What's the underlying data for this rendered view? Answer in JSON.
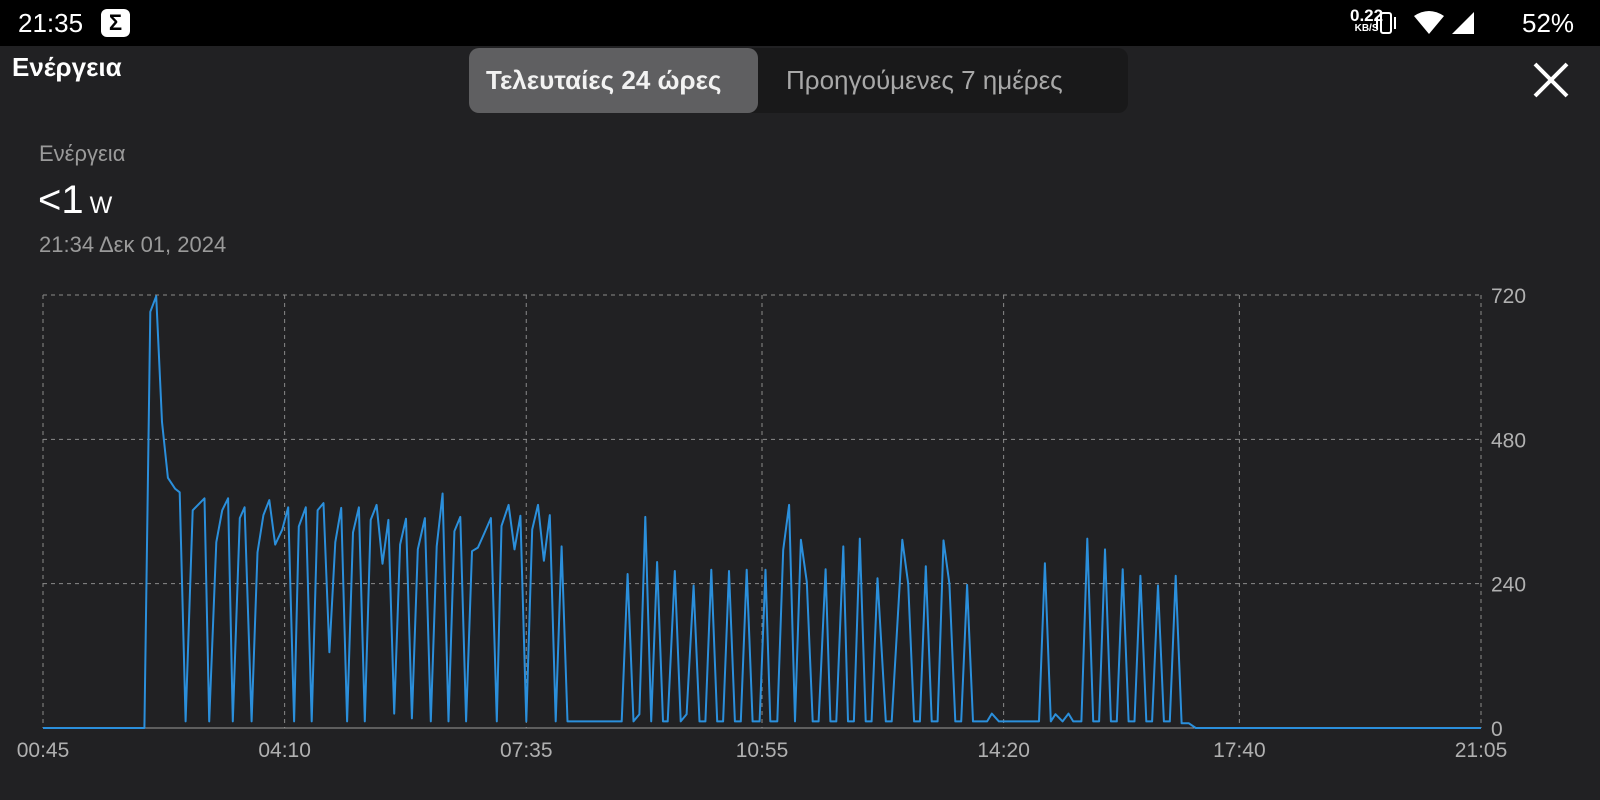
{
  "status_bar": {
    "time": "21:35",
    "app_icon": "sigma-icon",
    "app_icon_glyph": "Σ",
    "net_speed": "0.22",
    "net_unit": "KB/S",
    "battery": "52%"
  },
  "header": {
    "title": "Ενέργεια",
    "tabs": [
      {
        "label": "Τελευταίες 24 ώρες",
        "active": true
      },
      {
        "label": "Προηγούμενες 7 ημέρες",
        "active": false
      }
    ],
    "close_icon": "close-icon"
  },
  "summary": {
    "label": "Ενέργεια",
    "value": "<1",
    "unit": "W",
    "timestamp": "21:34  Δεκ 01, 2024"
  },
  "colors": {
    "line": "#2b8fdb",
    "background": "#212123",
    "grid": "#8a8a8a"
  },
  "chart_data": {
    "type": "line",
    "title": "",
    "xlabel": "",
    "ylabel": "W",
    "x_unit": "minutes since 00:45",
    "x_ticks": [
      {
        "label": "00:45",
        "value": 0
      },
      {
        "label": "04:10",
        "value": 205
      },
      {
        "label": "07:35",
        "value": 410
      },
      {
        "label": "10:55",
        "value": 610
      },
      {
        "label": "14:20",
        "value": 815
      },
      {
        "label": "17:40",
        "value": 1015
      },
      {
        "label": "21:05",
        "value": 1220
      }
    ],
    "xlim": [
      0,
      1220
    ],
    "y_ticks": [
      {
        "label": "720",
        "value": 720
      },
      {
        "label": "480",
        "value": 480
      },
      {
        "label": "240",
        "value": 240
      },
      {
        "label": "0",
        "value": 0
      }
    ],
    "ylim": [
      0,
      720
    ],
    "grid": true,
    "legend": "none",
    "series": [
      {
        "name": "Ενέργεια",
        "points": [
          [
            0,
            0
          ],
          [
            86,
            0
          ],
          [
            91,
            692
          ],
          [
            96,
            718
          ],
          [
            101,
            509
          ],
          [
            106,
            416
          ],
          [
            112,
            398
          ],
          [
            116,
            392
          ],
          [
            121,
            11
          ],
          [
            127,
            362
          ],
          [
            137,
            382
          ],
          [
            141,
            11
          ],
          [
            147,
            309
          ],
          [
            152,
            362
          ],
          [
            157,
            382
          ],
          [
            161,
            11
          ],
          [
            167,
            349
          ],
          [
            171,
            367
          ],
          [
            177,
            11
          ],
          [
            182,
            292
          ],
          [
            187,
            354
          ],
          [
            192,
            379
          ],
          [
            197,
            305
          ],
          [
            203,
            330
          ],
          [
            208,
            367
          ],
          [
            213,
            11
          ],
          [
            217,
            335
          ],
          [
            223,
            367
          ],
          [
            228,
            11
          ],
          [
            233,
            362
          ],
          [
            238,
            374
          ],
          [
            243,
            126
          ],
          [
            248,
            309
          ],
          [
            253,
            366
          ],
          [
            258,
            11
          ],
          [
            263,
            325
          ],
          [
            268,
            367
          ],
          [
            273,
            11
          ],
          [
            278,
            346
          ],
          [
            283,
            371
          ],
          [
            288,
            273
          ],
          [
            293,
            346
          ],
          [
            298,
            24
          ],
          [
            303,
            305
          ],
          [
            308,
            348
          ],
          [
            313,
            16
          ],
          [
            318,
            297
          ],
          [
            324,
            349
          ],
          [
            329,
            11
          ],
          [
            334,
            302
          ],
          [
            339,
            390
          ],
          [
            344,
            11
          ],
          [
            349,
            327
          ],
          [
            354,
            351
          ],
          [
            359,
            11
          ],
          [
            364,
            294
          ],
          [
            369,
            300
          ],
          [
            374,
            322
          ],
          [
            380,
            349
          ],
          [
            385,
            11
          ],
          [
            389,
            336
          ],
          [
            395,
            371
          ],
          [
            400,
            297
          ],
          [
            405,
            353
          ],
          [
            410,
            11
          ],
          [
            415,
            330
          ],
          [
            420,
            371
          ],
          [
            425,
            278
          ],
          [
            430,
            354
          ],
          [
            435,
            11
          ],
          [
            440,
            302
          ],
          [
            445,
            11
          ],
          [
            491,
            11
          ],
          [
            496,
            256
          ],
          [
            501,
            11
          ],
          [
            506,
            23
          ],
          [
            511,
            351
          ],
          [
            516,
            11
          ],
          [
            521,
            276
          ],
          [
            526,
            11
          ],
          [
            530,
            11
          ],
          [
            536,
            261
          ],
          [
            541,
            11
          ],
          [
            546,
            23
          ],
          [
            552,
            237
          ],
          [
            557,
            11
          ],
          [
            562,
            11
          ],
          [
            567,
            263
          ],
          [
            572,
            11
          ],
          [
            577,
            11
          ],
          [
            582,
            261
          ],
          [
            587,
            11
          ],
          [
            592,
            11
          ],
          [
            597,
            263
          ],
          [
            602,
            11
          ],
          [
            608,
            11
          ],
          [
            613,
            263
          ],
          [
            617,
            11
          ],
          [
            623,
            11
          ],
          [
            628,
            296
          ],
          [
            633,
            371
          ],
          [
            638,
            11
          ],
          [
            643,
            313
          ],
          [
            648,
            243
          ],
          [
            653,
            11
          ],
          [
            658,
            11
          ],
          [
            664,
            264
          ],
          [
            668,
            11
          ],
          [
            673,
            11
          ],
          [
            679,
            302
          ],
          [
            683,
            11
          ],
          [
            688,
            11
          ],
          [
            693,
            315
          ],
          [
            698,
            11
          ],
          [
            703,
            11
          ],
          [
            708,
            249
          ],
          [
            715,
            11
          ],
          [
            720,
            11
          ],
          [
            729,
            313
          ],
          [
            734,
            240
          ],
          [
            739,
            11
          ],
          [
            744,
            11
          ],
          [
            749,
            269
          ],
          [
            754,
            11
          ],
          [
            759,
            11
          ],
          [
            764,
            312
          ],
          [
            769,
            240
          ],
          [
            774,
            11
          ],
          [
            779,
            11
          ],
          [
            784,
            238
          ],
          [
            789,
            11
          ],
          [
            801,
            11
          ],
          [
            805,
            24
          ],
          [
            811,
            11
          ],
          [
            845,
            11
          ],
          [
            850,
            274
          ],
          [
            855,
            11
          ],
          [
            859,
            23
          ],
          [
            865,
            11
          ],
          [
            870,
            24
          ],
          [
            874,
            11
          ],
          [
            881,
            11
          ],
          [
            886,
            315
          ],
          [
            891,
            11
          ],
          [
            896,
            11
          ],
          [
            901,
            297
          ],
          [
            906,
            11
          ],
          [
            911,
            11
          ],
          [
            916,
            264
          ],
          [
            921,
            11
          ],
          [
            926,
            11
          ],
          [
            931,
            253
          ],
          [
            936,
            11
          ],
          [
            941,
            11
          ],
          [
            946,
            237
          ],
          [
            951,
            11
          ],
          [
            956,
            11
          ],
          [
            961,
            253
          ],
          [
            966,
            8
          ],
          [
            972,
            8
          ],
          [
            978,
            0
          ],
          [
            1220,
            0
          ]
        ]
      }
    ]
  }
}
